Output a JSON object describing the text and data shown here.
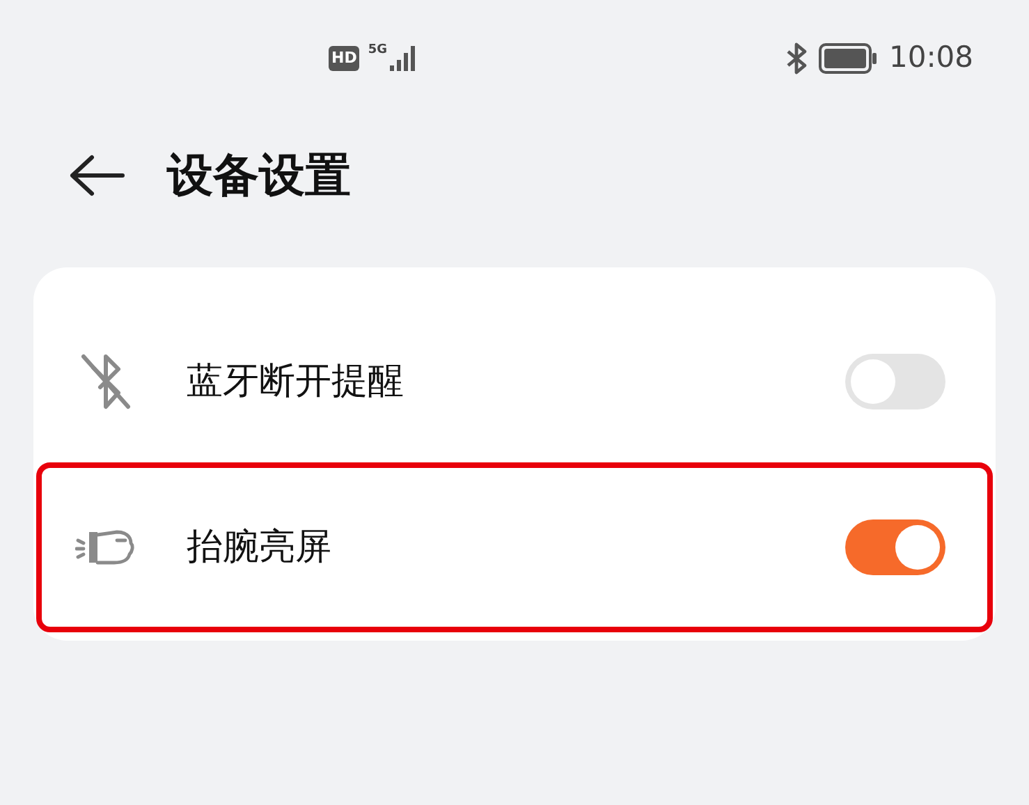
{
  "status_bar": {
    "hd_badge": "HD",
    "network": "5G",
    "time": "10:08"
  },
  "header": {
    "title": "设备设置"
  },
  "settings": [
    {
      "kind": "bluetooth",
      "label": "蓝牙断开提醒",
      "on": false,
      "highlighted": false
    },
    {
      "kind": "wrist",
      "label": "抬腕亮屏",
      "on": true,
      "highlighted": true
    }
  ]
}
